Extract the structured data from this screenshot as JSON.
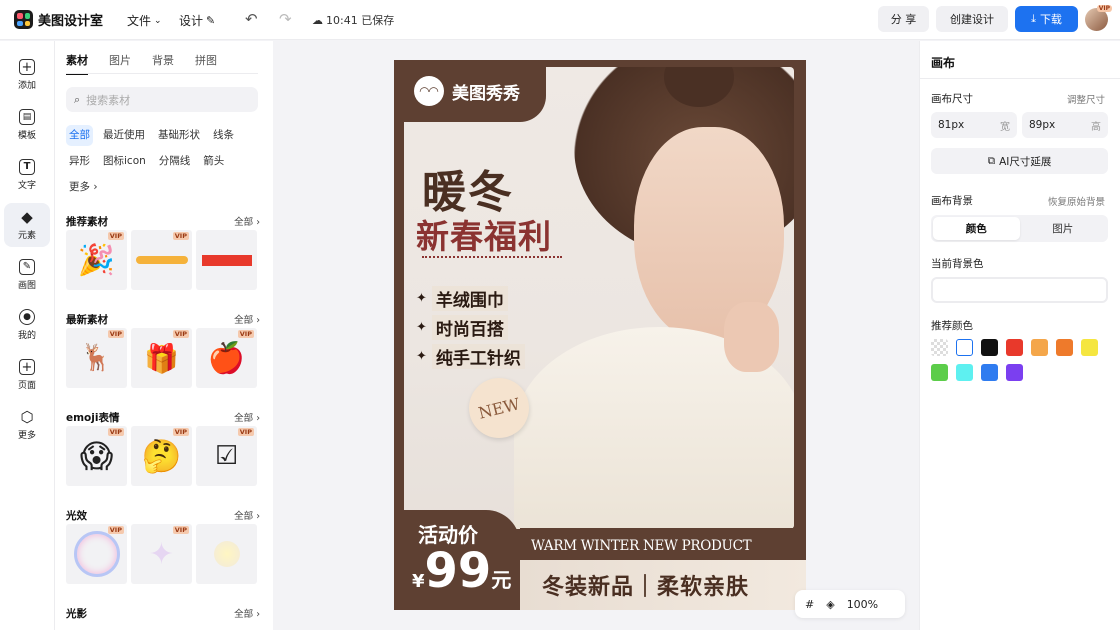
{
  "topbar": {
    "app_name": "美图设计室",
    "menu_file": "文件",
    "menu_design": "设计",
    "save_status": "10:41 已保存",
    "share_label": "分 享",
    "create_label": "创建设计",
    "download_label": "下载",
    "avatar_badge": "VIP"
  },
  "leftnav": [
    {
      "label": "添加",
      "icon": "plus-square-icon"
    },
    {
      "label": "模板",
      "icon": "template-icon"
    },
    {
      "label": "文字",
      "icon": "text-icon"
    },
    {
      "label": "元素",
      "icon": "shapes-icon"
    },
    {
      "label": "画图",
      "icon": "draw-icon"
    },
    {
      "label": "我的",
      "icon": "user-icon"
    },
    {
      "label": "页面",
      "icon": "add-page-icon"
    },
    {
      "label": "更多",
      "icon": "cube-icon"
    }
  ],
  "panel": {
    "tabs": [
      "素材",
      "图片",
      "背景",
      "拼图"
    ],
    "search_placeholder": "搜索素材",
    "chips": [
      "全部",
      "最近使用",
      "基础形状",
      "线条",
      "异形",
      "图标icon",
      "分隔线",
      "箭头",
      "更多"
    ],
    "all_label": "全部",
    "vip_label": "VIP",
    "sections": [
      {
        "title": "推荐素材"
      },
      {
        "title": "最新素材"
      },
      {
        "title": "emoji表情"
      },
      {
        "title": "光效"
      },
      {
        "title": "光影"
      }
    ]
  },
  "poster": {
    "brand": "美图秀秀",
    "headline": "暖冬",
    "subheadline": "新春福利",
    "features": [
      "羊绒围巾",
      "时尚百搭",
      "纯手工针织"
    ],
    "badge": "NEW",
    "price_label": "活动价",
    "price_currency": "¥",
    "price_value": "99",
    "price_unit": "元",
    "english_line": "WARM WINTER NEW PRODUCT",
    "slogan": "冬装新品｜柔软亲肤"
  },
  "zoom": {
    "level": "100%"
  },
  "rightpanel": {
    "title": "画布",
    "size_label": "画布尺寸",
    "size_adjust": "调整尺寸",
    "width_value": "81px",
    "width_unit": "宽",
    "height_value": "89px",
    "height_unit": "高",
    "ai_extend": "AI尺寸延展",
    "bg_label": "画布背景",
    "bg_restore": "恢复原始背景",
    "bg_tabs": [
      "颜色",
      "图片"
    ],
    "current_bg_label": "当前背景色",
    "recommended_label": "推荐颜色",
    "swatches": [
      "transparent",
      "#ffffff",
      "#111111",
      "#e8392b",
      "#f4a64a",
      "#ee7a2b",
      "#f5e640",
      "#5ccd4a",
      "#5ef0f0",
      "#2f7cf0",
      "#7b3ff0"
    ]
  },
  "colors": {
    "accent": "#1d72f0",
    "poster_brown": "#5e4032",
    "promo_red": "#8b3331"
  }
}
